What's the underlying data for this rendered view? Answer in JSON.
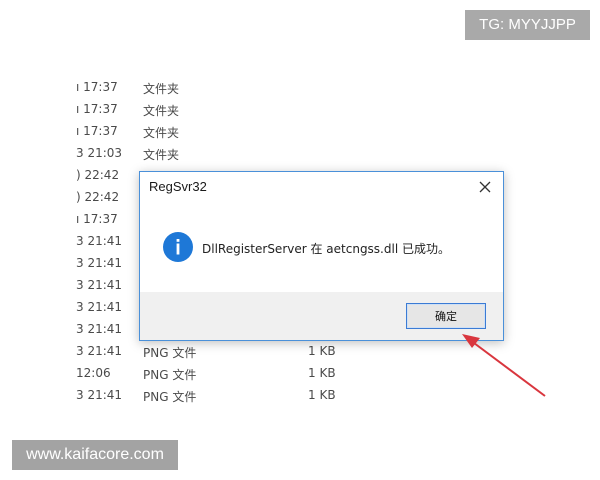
{
  "watermarks": {
    "top": "TG: MYYJJPP",
    "bottom": "www.kaifacore.com"
  },
  "file_list": {
    "rows": [
      {
        "time": "ı 17:37",
        "type": "文件夹",
        "size": ""
      },
      {
        "time": "ı 17:37",
        "type": "文件夹",
        "size": ""
      },
      {
        "time": "ı 17:37",
        "type": "文件夹",
        "size": ""
      },
      {
        "time": "3 21:03",
        "type": "文件夹",
        "size": ""
      },
      {
        "time": ") 22:42",
        "type": "",
        "size": ""
      },
      {
        "time": ") 22:42",
        "type": "",
        "size": ""
      },
      {
        "time": "ı 17:37",
        "type": "",
        "size": ""
      },
      {
        "time": "3 21:41",
        "type": "",
        "size": ""
      },
      {
        "time": "3 21:41",
        "type": "",
        "size": ""
      },
      {
        "time": "3 21:41",
        "type": "",
        "size": ""
      },
      {
        "time": "3 21:41",
        "type": "",
        "size": ""
      },
      {
        "time": "3 21:41",
        "type": "",
        "size": ""
      },
      {
        "time": "3 21:41",
        "type": "PNG 文件",
        "size": "1 KB"
      },
      {
        "time": "12:06",
        "type": "PNG 文件",
        "size": "1 KB"
      },
      {
        "time": "3 21:41",
        "type": "PNG 文件",
        "size": "1 KB"
      }
    ]
  },
  "dialog": {
    "title": "RegSvr32",
    "message": "DllRegisterServer 在 aetcngss.dll 已成功。",
    "ok_label": "确定",
    "icon": "info-icon",
    "close_icon": "close-icon"
  },
  "colors": {
    "info_icon": "#1e78d7",
    "dialog_border": "#4a90d9",
    "arrow": "#d9363e"
  }
}
